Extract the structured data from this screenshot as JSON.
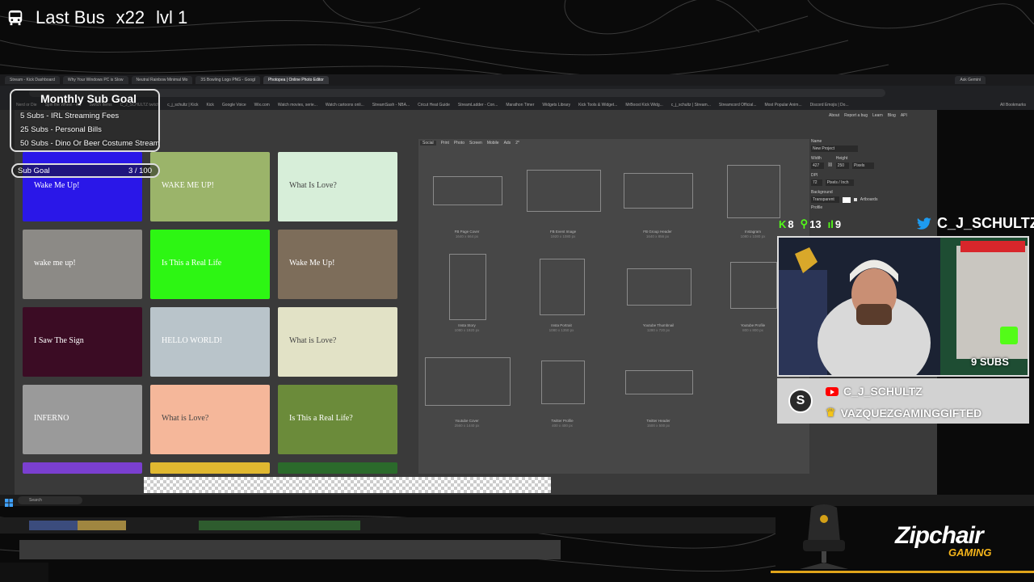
{
  "hud": {
    "title": "Last Bus",
    "multiplier": "x22",
    "level": "lvl 1",
    "icon": "bus-icon"
  },
  "browser": {
    "tabs": [
      "Stream - Kick Dashboard",
      "Why Your Windows PC is Slow",
      "Neutral Rainbow Minimal Mo",
      "3S Bowling Logo PNG - Googl",
      "Photopea | Online Photo Editor"
    ],
    "bookmarks": [
      "Nerd or Die",
      "Spin the Wheel - Ra",
      "Switch Items",
      "C_J_SCHULTZ twitch",
      "c_j_schultz | Kick",
      "Kick",
      "Google Voice",
      "Wix.com",
      "Watch movies, serie...",
      "Watch cartoons onli...",
      "StreamSash - NBA...",
      "Cricut Heat Guide",
      "StreamLadder - Con...",
      "Marathon Timer",
      "Widgets Library",
      "Kick Tools & Widget...",
      "MrBoost Kick Widg...",
      "c_j_schultz | Stream...",
      "Streamcord Official...",
      "Most Popular Anim...",
      "Discord Emojis | Do..."
    ],
    "all_bookmarks": "All Bookmarks",
    "ask_gemini": "Ask Gemini"
  },
  "photopea": {
    "size_tabs": [
      "Social",
      "Print",
      "Photo",
      "Screen",
      "Mobile",
      "Ads",
      "2*"
    ],
    "thumbnails": [
      {
        "caption": "Wake Me Up!",
        "bg": "#2a17e8"
      },
      {
        "caption": "WAKE ME UP!",
        "bg": "#9bb46a"
      },
      {
        "caption": "What Is Love?",
        "bg": "#d7eed9"
      },
      {
        "caption": "wake me up!",
        "bg": "#8c8a86"
      },
      {
        "caption": "Is This a Real Life",
        "bg": "#2df613"
      },
      {
        "caption": "Wake Me Up!",
        "bg": "#7d6d5a"
      },
      {
        "caption": "I Saw The Sign",
        "bg": "#3b0c24"
      },
      {
        "caption": "HELLO WORLD!",
        "bg": "#b9c4ca"
      },
      {
        "caption": "What is Love?",
        "bg": "#e2e2c6"
      },
      {
        "caption": "INFERNO",
        "bg": "#9a9a9a"
      },
      {
        "caption": "What is Love?",
        "bg": "#f5b79a"
      },
      {
        "caption": "Is This a Real Life?",
        "bg": "#6b8b3a"
      }
    ],
    "frames": [
      {
        "name": "FB Page Cover",
        "dims": "1640 x 664 px"
      },
      {
        "name": "FB Event Image",
        "dims": "1920 x 1080 px"
      },
      {
        "name": "FB Group Header",
        "dims": "1640 x 856 px"
      },
      {
        "name": "Instagram",
        "dims": "1080 x 1080 px"
      },
      {
        "name": "Insta Story",
        "dims": "1080 x 1920 px"
      },
      {
        "name": "Insta Portrait",
        "dims": "1080 x 1350 px"
      },
      {
        "name": "Youtube Thumbnail",
        "dims": "1280 x 720 px"
      },
      {
        "name": "Youtube Profile",
        "dims": "800 x 800 px"
      },
      {
        "name": "Youtube Cover",
        "dims": "2560 x 1440 px"
      },
      {
        "name": "Twitter Profile",
        "dims": "400 x 400 px"
      },
      {
        "name": "Twitter Header",
        "dims": "1500 x 500 px"
      }
    ],
    "panel": {
      "name_label": "Name",
      "name_value": "New Project",
      "width_label": "Width",
      "height_label": "Height",
      "width": "427",
      "height": "250",
      "unit": "Pixels",
      "dpi_label": "DPI",
      "dpi": "72",
      "dpi_unit": "Pixels / Inch",
      "bg_label": "Background",
      "bg_value": "Transparent",
      "artboards": "Artboards",
      "profile_label": "Profile"
    },
    "top_links": [
      "About",
      "Report a bug",
      "Learn",
      "Blog",
      "API"
    ]
  },
  "taskbar": {
    "search_placeholder": "Search"
  },
  "goal": {
    "title": "Monthly Sub Goal",
    "lines": [
      "5 Subs - IRL Streaming Fees",
      "25 Subs - Personal Bills",
      "50 Subs - Dino Or Beer Costume Stream"
    ],
    "bar_label": "Sub Goal",
    "bar_value": "3 / 100",
    "progress_fraction": 0.03
  },
  "counters": {
    "kick": "8",
    "followers": "13",
    "viewers": "9"
  },
  "social": {
    "twitter": "C_J_SCHULTZ",
    "youtube": "C_J_SCHULTZ",
    "gifted": "VAZQUEZGAMINGGIFTED",
    "subs_badge": "9 SUBS",
    "plate_logo": "S"
  },
  "sponsor": {
    "brand": "Zipchair",
    "sub": "GAMING",
    "color": "#f5b51b"
  }
}
